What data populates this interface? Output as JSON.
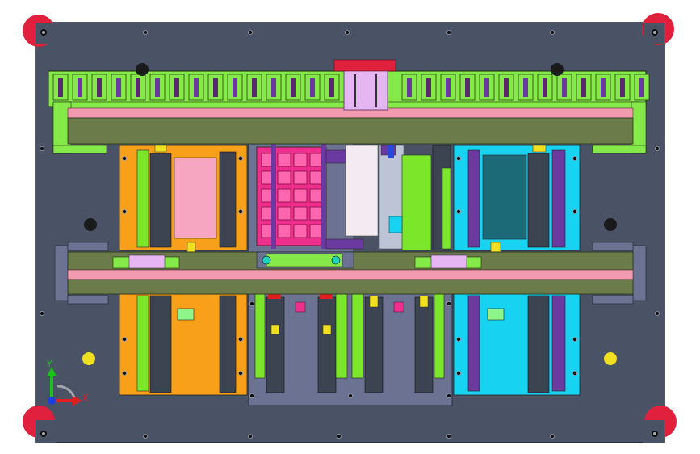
{
  "view": {
    "background": "#ffffff",
    "plate_color": "#4a5366",
    "edge_color": "#1c2230"
  },
  "colors": {
    "corner_foot": "#e0203c",
    "rail_green": "#86e94a",
    "rail_olive": "#6b7c4a",
    "rail_pink": "#f29ab0",
    "block_orange": "#f9a01b",
    "block_cyan": "#18d2f2",
    "block_magenta": "#ee2f8e",
    "block_purple": "#6a3aa0",
    "block_gray_blue": "#6c7392",
    "panel_pink": "#f7a6c2",
    "panel_teal": "#1c6a78",
    "panel_dark": "#3c4452",
    "bright_green": "#7ce62b",
    "mint": "#8ef58a",
    "lavender": "#e6b6f2",
    "yellow": "#f0e020"
  },
  "triad": {
    "y_label": "Y",
    "x_label": "X",
    "y_color": "#19c219",
    "x_color": "#e02020",
    "z_color": "#1f3fe0"
  }
}
